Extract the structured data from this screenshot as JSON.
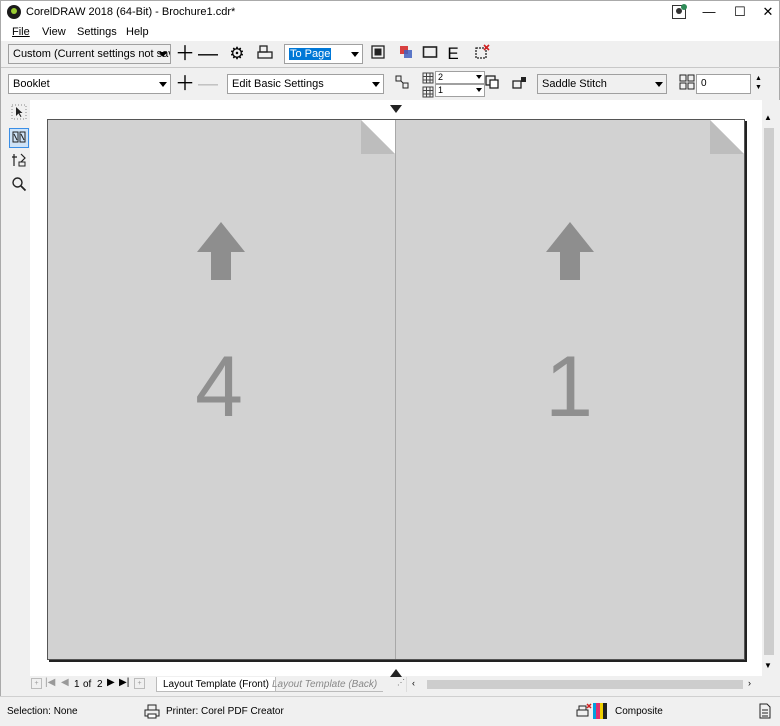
{
  "window": {
    "title": "CorelDRAW 2018 (64-Bit) - Brochure1.cdr*",
    "minimize": "—",
    "maximize": "☐",
    "close": "✕"
  },
  "menu": [
    "File",
    "View",
    "Settings",
    "Help"
  ],
  "toolbar1": {
    "preset": "Custom (Current settings not saved)",
    "zoom": "To Page"
  },
  "toolbar2": {
    "layout": "Booklet",
    "settings_mode": "Edit Basic Settings",
    "rows": "2",
    "cols": "1",
    "binding": "Saddle Stitch",
    "gutter": "0"
  },
  "pages": {
    "left_number": "4",
    "right_number": "1"
  },
  "navigation": {
    "current": "1",
    "of_label": "of",
    "total": "2",
    "tab_front": "Layout Template (Front)",
    "tab_back": "Layout Template (Back)"
  },
  "status": {
    "selection": "Selection: None",
    "printer": "Printer: Corel PDF Creator",
    "mode": "Composite"
  }
}
